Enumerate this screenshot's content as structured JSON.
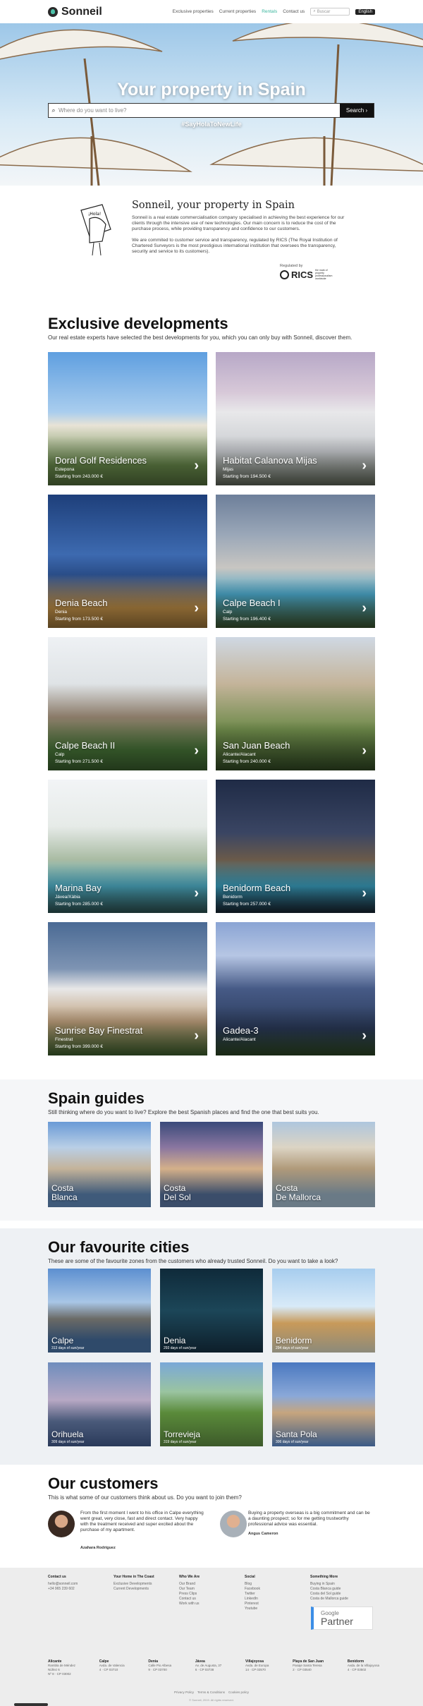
{
  "header": {
    "logo": "Sonneil",
    "nav": [
      "Exclusive properties",
      "Current properties",
      "Rentals",
      "Contact us"
    ],
    "search_placeholder": "Buscar",
    "lang": "English"
  },
  "hero": {
    "title": "Your property in Spain",
    "search_placeholder": "Where do you want to live?",
    "search_button": "Search",
    "hashtag": "#SayHolaToNewLife"
  },
  "intro": {
    "badge": "¡Hola!",
    "title": "Sonneil, your property in Spain",
    "p1": "Sonneil is a real estate commercialisation company specialised in achieving the best experience for our clients through the intensive use of new technologies. Our main concern is to reduce the cost of the purchase process, while providing transparency and confidence to our customers.",
    "p2": "We are commited to customer service and transparency, regulated by RICS (The Royal Institution of Chartered Surveyors is the most prestigious international institution that oversees the transparency, security and service to its customers).",
    "regulated": "Regulated by",
    "rics": "RICS",
    "rics_small": "the mark of property professionalism worldwide"
  },
  "developments": {
    "title": "Exclusive developments",
    "subtitle": "Our real estate experts have selected the best developments for you, which you can only buy with Sonneil, discover them.",
    "items": [
      {
        "name": "Doral Golf Residences",
        "loc": "Estepona",
        "price": "Starting from 243.000 €"
      },
      {
        "name": "Habitat Calanova Mijas",
        "loc": "Mijas",
        "price": "Starting from 194.500 €"
      },
      {
        "name": "Denia Beach",
        "loc": "Denia",
        "price": "Starting from 173.500 €"
      },
      {
        "name": "Calpe Beach I",
        "loc": "Calp",
        "price": "Starting from 196.400 €"
      },
      {
        "name": "Calpe Beach II",
        "loc": "Calp",
        "price": "Starting from 271.500 €"
      },
      {
        "name": "San Juan Beach",
        "loc": "Alicante/Alacant",
        "price": "Starting from 240.000 €"
      },
      {
        "name": "Marina Bay",
        "loc": "Jávea/Xàbia",
        "price": "Starting from 285.000 €"
      },
      {
        "name": "Benidorm Beach",
        "loc": "Benidorm",
        "price": "Starting from 257.000 €"
      },
      {
        "name": "Sunrise Bay Finestrat",
        "loc": "Finestrat",
        "price": "Starting from 399.000 €"
      },
      {
        "name": "Gadea-3",
        "loc": "Alicante/Alacant",
        "price": ""
      }
    ]
  },
  "guides": {
    "title": "Spain guides",
    "subtitle": "Still thinking where do you want to live? Explore the best Spanish places and find the one that best suits you.",
    "items": [
      [
        "Costa",
        "Blanca"
      ],
      [
        "Costa",
        "Del Sol"
      ],
      [
        "Costa",
        "De Mallorca"
      ]
    ]
  },
  "cities": {
    "title": "Our favourite cities",
    "subtitle": "These are some of the favourite zones from the customers who already trusted Sonneil. Do you want to take a look?",
    "items": [
      {
        "name": "Calpe",
        "days": "313 days of sun/year"
      },
      {
        "name": "Denia",
        "days": "293 days of sun/year"
      },
      {
        "name": "Benidorm",
        "days": "294 days of sun/year"
      },
      {
        "name": "Orihuela",
        "days": "309 days of sun/year"
      },
      {
        "name": "Torrevieja",
        "days": "319 days of sun/year"
      },
      {
        "name": "Santa Pola",
        "days": "306 days of sun/year"
      }
    ]
  },
  "customers": {
    "title": "Our customers",
    "subtitle": "This is what some of our customers think about us. Do you want to join them?",
    "quotes": [
      {
        "text": "From the first moment I went to his office in Calpe everything went great, very close, fast and direct contact. Very happy with the treatment received and super excited about the purchase of my apartment.",
        "name": "Azahara Rodríguez"
      },
      {
        "text": "Buying a property overseas is a big commitment and can be a daunting prospect; so for me getting trustworthy professional advice was essential.",
        "name": "Angus Cameron"
      }
    ]
  },
  "footer": {
    "cols": [
      {
        "h": "Contact us",
        "items": [
          "hello@sonneil.com",
          "+34 965 239 602"
        ]
      },
      {
        "h": "Your Home in The Coast",
        "items": [
          "Exclusive Developments",
          "Current Developments"
        ]
      },
      {
        "h": "Who We Are",
        "items": [
          "Our Brand",
          "Our Team",
          "Press Clips",
          "Contact us",
          "Work with us"
        ]
      },
      {
        "h": "Social",
        "items": [
          "Blog",
          "Facebook",
          "Twitter",
          "LinkedIn",
          "Pinterest",
          "Youtube"
        ]
      },
      {
        "h": "Something More",
        "items": [
          "Buying in Spain",
          "Costa Blanca guide",
          "Costa del Sol guide",
          "Costa de Mallorca guide"
        ]
      }
    ],
    "partner": [
      "Google",
      "Partner"
    ],
    "offices": [
      {
        "h": "Alicante",
        "l": [
          "Rambla de Méndez",
          "Núñez 6",
          "Nº 8 · CP 03002"
        ]
      },
      {
        "h": "Calpe",
        "l": [
          "Avda. de Valencia",
          "4 · CP 03710"
        ]
      },
      {
        "h": "Denia",
        "l": [
          "Calle Pio Albesa",
          "9 · CP 03700"
        ]
      },
      {
        "h": "Jávea",
        "l": [
          "Av. de Augusta, 37",
          "6 · CP 03738"
        ]
      },
      {
        "h": "Villajoyosa",
        "l": [
          "Avda. de Europa",
          "14 · CP 03570"
        ]
      },
      {
        "h": "Playa de San Juan",
        "l": [
          "Pasaje Santa Teresa",
          "2 · CP 03540"
        ]
      },
      {
        "h": "Benidorm",
        "l": [
          "Avda. de la Villajoyosa",
          "4 · CP 03502"
        ]
      }
    ],
    "legal": [
      "Privacy Policy",
      "Terms & Conditions",
      "Cookies policy"
    ],
    "copy": "© Sonneil, 2019. All rights reserved."
  }
}
